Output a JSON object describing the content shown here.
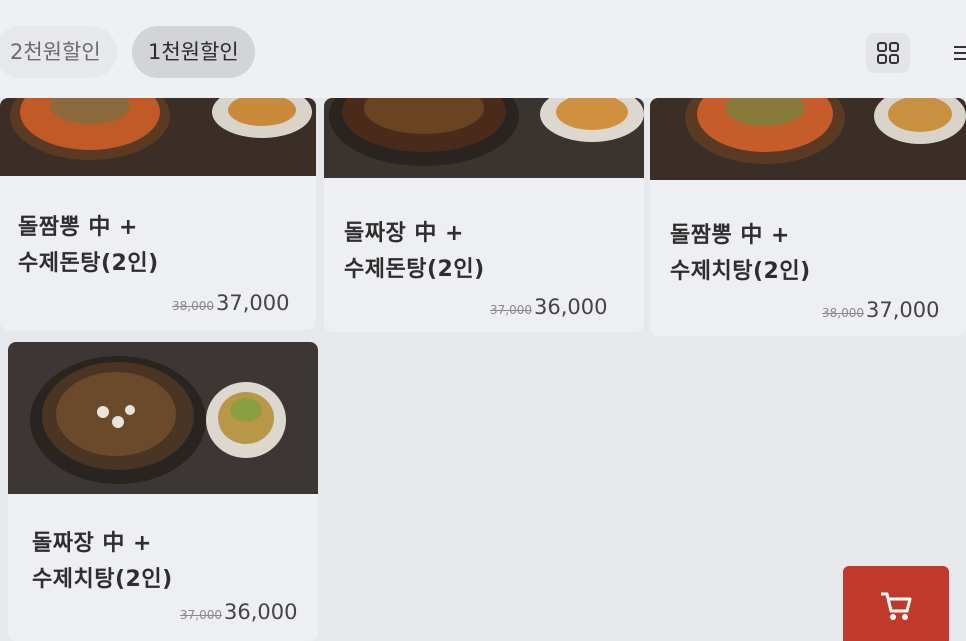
{
  "tabs": [
    {
      "label": "2천원할인"
    },
    {
      "label": "1천원할인"
    }
  ],
  "menu_items": [
    {
      "line1": "돌짬뽕 中 +",
      "line2": "수제돈탕(2인)",
      "old_price": "38,000",
      "price": "37,000"
    },
    {
      "line1": "돌짜장 中 +",
      "line2": "수제돈탕(2인)",
      "old_price": "37,000",
      "price": "36,000"
    },
    {
      "line1": "돌짬뽕 中 +",
      "line2": "수제치탕(2인)",
      "old_price": "38,000",
      "price": "37,000"
    },
    {
      "line1": "돌짜장 中 +",
      "line2": "수제치탕(2인)",
      "old_price": "37,000",
      "price": "36,000"
    }
  ],
  "icons": {
    "view_toggle": "grid-icon",
    "list": "list-icon",
    "cart": "cart-icon"
  },
  "colors": {
    "cart_button": "#c0392b",
    "selected_tab": "#d2d4d8"
  }
}
